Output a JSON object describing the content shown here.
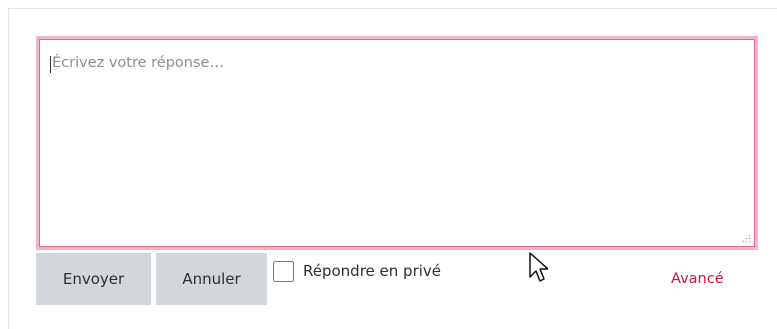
{
  "reply_form": {
    "textarea_placeholder": "Écrivez votre réponse…",
    "textarea_value": "",
    "send_label": "Envoyer",
    "cancel_label": "Annuler",
    "private_label": "Répondre en privé",
    "private_checked": false,
    "advanced_label": "Avancé"
  },
  "icons": {
    "resize_grip": "resize-grip-icon",
    "mouse_pointer": "mouse-pointer-icon"
  },
  "colors": {
    "focus_border": "#e56a8a",
    "focus_glow": "#f4b4c4",
    "button_bg": "#d3d6db",
    "link": "#c8173f"
  }
}
